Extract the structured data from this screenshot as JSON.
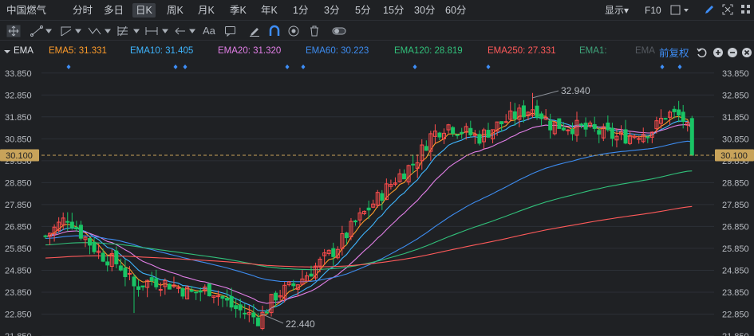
{
  "stock_name": "中国燃气",
  "period_tabs": [
    "分时",
    "多日",
    "日K",
    "周K",
    "月K",
    "季K",
    "年K",
    "1分",
    "3分",
    "5分",
    "15分",
    "30分",
    "60分"
  ],
  "active_tab": "日K",
  "toolbar_right": {
    "display_label": "显示▾",
    "f10_label": "F10"
  },
  "indicator": {
    "name": "EMA",
    "fq_label": "前复权",
    "emas": [
      {
        "label": "EMA5: 31.331",
        "color": "#ff9c2a"
      },
      {
        "label": "EMA10: 31.405",
        "color": "#3fb6ff"
      },
      {
        "label": "EMA20: 31.320",
        "color": "#e27fe7"
      },
      {
        "label": "EMA60: 30.223",
        "color": "#3d8cf0"
      },
      {
        "label": "EMA120: 28.819",
        "color": "#31c07a"
      },
      {
        "label": "EMA250: 27.331",
        "color": "#ff5a5a"
      },
      {
        "label": "EMA1:",
        "color": "#3fa37a"
      },
      {
        "label": "EMA",
        "color": "#555a61"
      }
    ]
  },
  "tools": {
    "aa_label": "Aa"
  },
  "chart_data": {
    "type": "candlestick",
    "y_ticks": [
      "33.850",
      "32.850",
      "31.850",
      "30.850",
      "29.850",
      "28.850",
      "27.850",
      "26.850",
      "25.850",
      "24.850",
      "23.850",
      "22.850",
      "21.850"
    ],
    "ylim": [
      21.85,
      34.35
    ],
    "current_price": "30.100",
    "annotations": {
      "high": "32.940",
      "low": "22.440"
    },
    "colors": {
      "up": "#ff4d4d",
      "down": "#19c465",
      "price_line": "#c8a35a"
    }
  }
}
